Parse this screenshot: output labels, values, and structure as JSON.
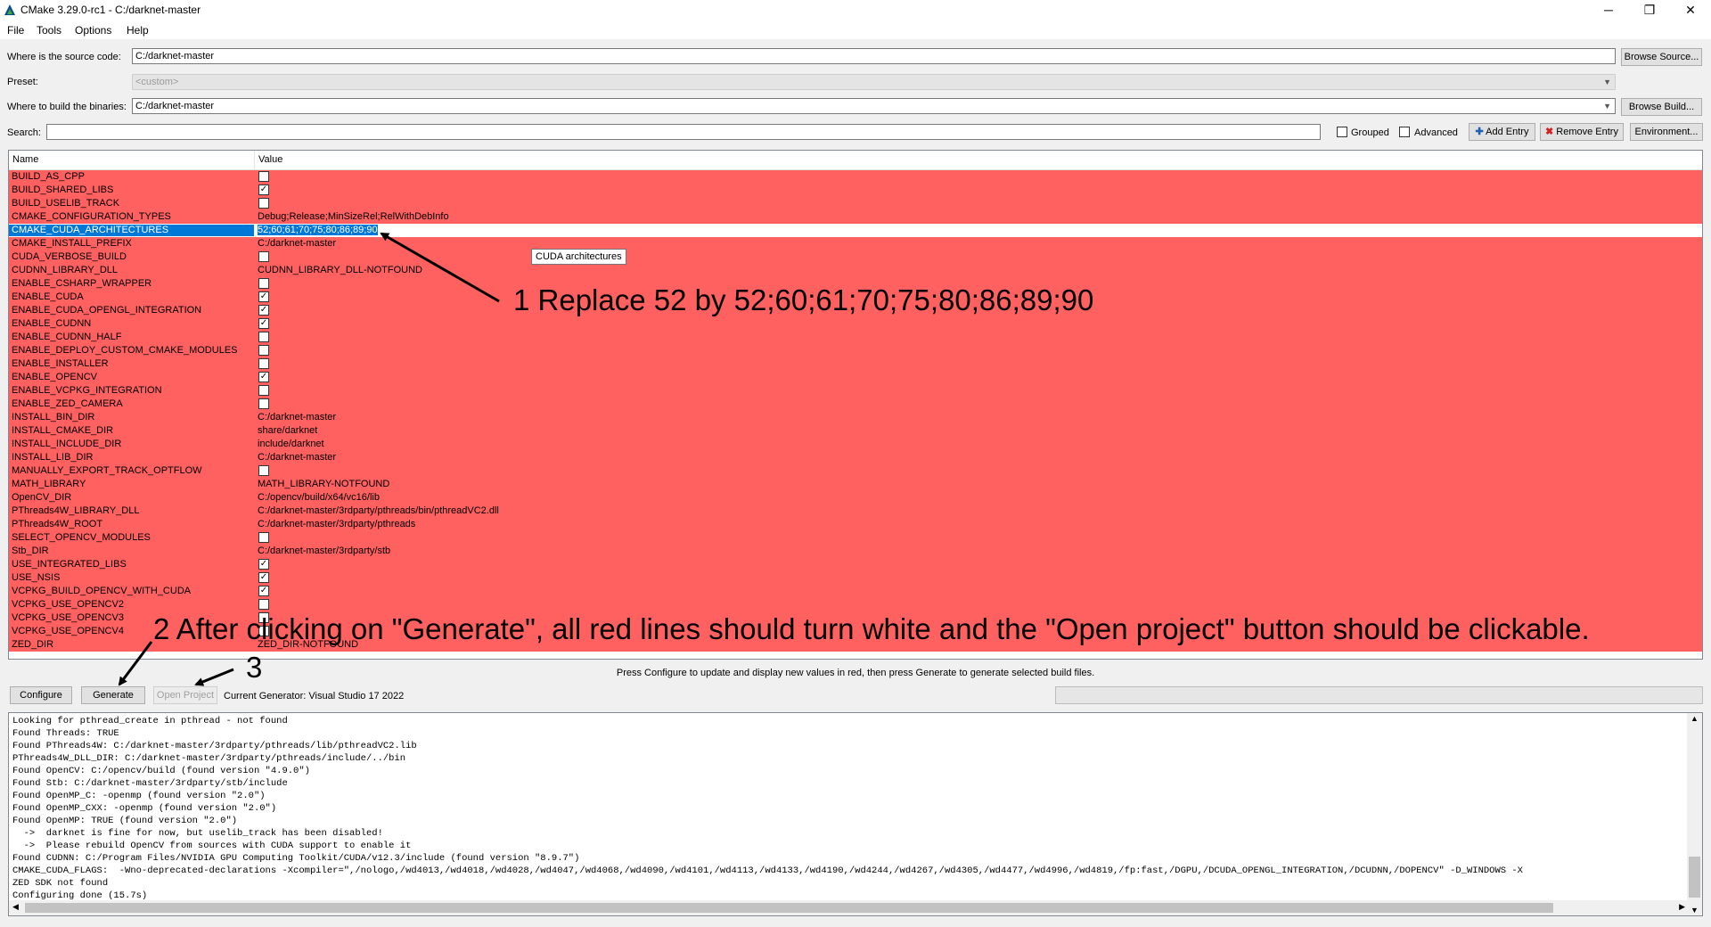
{
  "window": {
    "title": "CMake 3.29.0-rc1 - C:/darknet-master",
    "minimize": "─",
    "maximize": "❐",
    "close": "✕"
  },
  "menu": [
    "File",
    "Tools",
    "Options",
    "Help"
  ],
  "source": {
    "label": "Where is the source code:",
    "value": "C:/darknet-master",
    "browse_label": "Browse Source..."
  },
  "preset": {
    "label": "Preset:",
    "value": "<custom>"
  },
  "build": {
    "label": "Where to build the binaries:",
    "value": "C:/darknet-master",
    "browse_label": "Browse Build..."
  },
  "search": {
    "label": "Search:",
    "value": ""
  },
  "options": {
    "grouped_label": "Grouped",
    "advanced_label": "Advanced",
    "add_entry_label": "Add Entry",
    "remove_entry_label": "Remove Entry",
    "environment_label": "Environment..."
  },
  "table": {
    "name_header": "Name",
    "value_header": "Value",
    "rows": [
      {
        "name": "BUILD_AS_CPP",
        "type": "bool",
        "checked": false
      },
      {
        "name": "BUILD_SHARED_LIBS",
        "type": "bool",
        "checked": true
      },
      {
        "name": "BUILD_USELIB_TRACK",
        "type": "bool",
        "checked": false
      },
      {
        "name": "CMAKE_CONFIGURATION_TYPES",
        "type": "text",
        "value": "Debug;Release;MinSizeRel;RelWithDebInfo"
      },
      {
        "name": "CMAKE_CUDA_ARCHITECTURES",
        "type": "text",
        "value": "52;60;61;70;75;80;86;89;90",
        "selected": true
      },
      {
        "name": "CMAKE_INSTALL_PREFIX",
        "type": "text",
        "value": "C:/darknet-master"
      },
      {
        "name": "CUDA_VERBOSE_BUILD",
        "type": "bool",
        "checked": false
      },
      {
        "name": "CUDNN_LIBRARY_DLL",
        "type": "text",
        "value": "CUDNN_LIBRARY_DLL-NOTFOUND"
      },
      {
        "name": "ENABLE_CSHARP_WRAPPER",
        "type": "bool",
        "checked": false
      },
      {
        "name": "ENABLE_CUDA",
        "type": "bool",
        "checked": true
      },
      {
        "name": "ENABLE_CUDA_OPENGL_INTEGRATION",
        "type": "bool",
        "checked": true
      },
      {
        "name": "ENABLE_CUDNN",
        "type": "bool",
        "checked": true
      },
      {
        "name": "ENABLE_CUDNN_HALF",
        "type": "bool",
        "checked": false
      },
      {
        "name": "ENABLE_DEPLOY_CUSTOM_CMAKE_MODULES",
        "type": "bool",
        "checked": false
      },
      {
        "name": "ENABLE_INSTALLER",
        "type": "bool",
        "checked": false
      },
      {
        "name": "ENABLE_OPENCV",
        "type": "bool",
        "checked": true
      },
      {
        "name": "ENABLE_VCPKG_INTEGRATION",
        "type": "bool",
        "checked": false
      },
      {
        "name": "ENABLE_ZED_CAMERA",
        "type": "bool",
        "checked": false
      },
      {
        "name": "INSTALL_BIN_DIR",
        "type": "text",
        "value": "C:/darknet-master"
      },
      {
        "name": "INSTALL_CMAKE_DIR",
        "type": "text",
        "value": "share/darknet"
      },
      {
        "name": "INSTALL_INCLUDE_DIR",
        "type": "text",
        "value": "include/darknet"
      },
      {
        "name": "INSTALL_LIB_DIR",
        "type": "text",
        "value": "C:/darknet-master"
      },
      {
        "name": "MANUALLY_EXPORT_TRACK_OPTFLOW",
        "type": "bool",
        "checked": false
      },
      {
        "name": "MATH_LIBRARY",
        "type": "text",
        "value": "MATH_LIBRARY-NOTFOUND"
      },
      {
        "name": "OpenCV_DIR",
        "type": "text",
        "value": "C:/opencv/build/x64/vc16/lib"
      },
      {
        "name": "PThreads4W_LIBRARY_DLL",
        "type": "text",
        "value": "C:/darknet-master/3rdparty/pthreads/bin/pthreadVC2.dll"
      },
      {
        "name": "PThreads4W_ROOT",
        "type": "text",
        "value": "C:/darknet-master/3rdparty/pthreads"
      },
      {
        "name": "SELECT_OPENCV_MODULES",
        "type": "bool",
        "checked": false
      },
      {
        "name": "Stb_DIR",
        "type": "text",
        "value": "C:/darknet-master/3rdparty/stb"
      },
      {
        "name": "USE_INTEGRATED_LIBS",
        "type": "bool",
        "checked": true
      },
      {
        "name": "USE_NSIS",
        "type": "bool",
        "checked": true
      },
      {
        "name": "VCPKG_BUILD_OPENCV_WITH_CUDA",
        "type": "bool",
        "checked": true
      },
      {
        "name": "VCPKG_USE_OPENCV2",
        "type": "bool",
        "checked": false
      },
      {
        "name": "VCPKG_USE_OPENCV3",
        "type": "bool",
        "checked": false
      },
      {
        "name": "VCPKG_USE_OPENCV4",
        "type": "bool",
        "checked": false
      },
      {
        "name": "ZED_DIR",
        "type": "text",
        "value": "ZED_DIR-NOTFOUND"
      }
    ]
  },
  "tooltip": "CUDA architectures",
  "annotations": {
    "one": "1 Replace 52 by 52;60;61;70;75;80;86;89;90",
    "two": "2 After clicking on \"Generate\", all red lines should turn white and the \"Open project\" button should be clickable.",
    "three": "3"
  },
  "hint": "Press Configure to update and display new values in red, then press Generate to generate selected build files.",
  "buttons": {
    "configure": "Configure",
    "generate": "Generate",
    "open_project": "Open Project"
  },
  "generator": "Current Generator: Visual Studio 17 2022",
  "output": [
    "Looking for pthread_create in pthread - not found",
    "Found Threads: TRUE",
    "Found PThreads4W: C:/darknet-master/3rdparty/pthreads/lib/pthreadVC2.lib",
    "PThreads4W_DLL_DIR: C:/darknet-master/3rdparty/pthreads/include/../bin",
    "Found OpenCV: C:/opencv/build (found version \"4.9.0\")",
    "Found Stb: C:/darknet-master/3rdparty/stb/include",
    "Found OpenMP_C: -openmp (found version \"2.0\")",
    "Found OpenMP_CXX: -openmp (found version \"2.0\")",
    "Found OpenMP: TRUE (found version \"2.0\")",
    "  ->  darknet is fine for now, but uselib_track has been disabled!",
    "  ->  Please rebuild OpenCV from sources with CUDA support to enable it",
    "Found CUDNN: C:/Program Files/NVIDIA GPU Computing Toolkit/CUDA/v12.3/include (found version \"8.9.7\")",
    "CMAKE_CUDA_FLAGS:  -Wno-deprecated-declarations -Xcompiler=\",/nologo,/wd4013,/wd4018,/wd4028,/wd4047,/wd4068,/wd4090,/wd4101,/wd4113,/wd4133,/wd4190,/wd4244,/wd4267,/wd4305,/wd4477,/wd4996,/wd4819,/fp:fast,/DGPU,/DCUDA_OPENGL_INTEGRATION,/DCUDNN,/DOPENCV\" -D_WINDOWS -X",
    "ZED SDK not found",
    "Configuring done (15.7s)"
  ]
}
